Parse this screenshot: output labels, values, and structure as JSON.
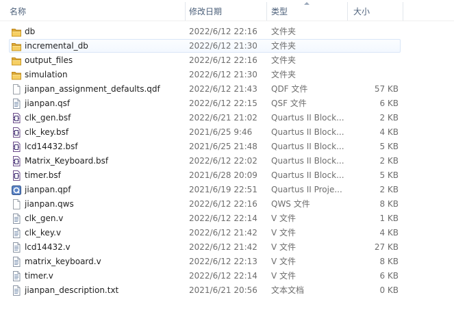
{
  "columns": {
    "name": "名称",
    "date": "修改日期",
    "type": "类型",
    "size": "大小"
  },
  "files": [
    {
      "name": "db",
      "date": "2022/6/12 22:16",
      "type": "文件夹",
      "size": "",
      "icon": "folder-icon"
    },
    {
      "name": "incremental_db",
      "date": "2022/6/12 21:30",
      "type": "文件夹",
      "size": "",
      "icon": "folder-icon"
    },
    {
      "name": "output_files",
      "date": "2022/6/12 22:16",
      "type": "文件夹",
      "size": "",
      "icon": "folder-icon"
    },
    {
      "name": "simulation",
      "date": "2022/6/12 21:30",
      "type": "文件夹",
      "size": "",
      "icon": "folder-icon"
    },
    {
      "name": "jianpan_assignment_defaults.qdf",
      "date": "2022/6/12 21:43",
      "type": "QDF 文件",
      "size": "57 KB",
      "icon": "blank-file-icon"
    },
    {
      "name": "jianpan.qsf",
      "date": "2022/6/12 22:15",
      "type": "QSF 文件",
      "size": "6 KB",
      "icon": "text-file-icon"
    },
    {
      "name": "clk_gen.bsf",
      "date": "2022/6/21 21:02",
      "type": "Quartus II Block...",
      "size": "2 KB",
      "icon": "quartus-block-icon"
    },
    {
      "name": "clk_key.bsf",
      "date": "2021/6/25 9:46",
      "type": "Quartus II Block...",
      "size": "4 KB",
      "icon": "quartus-block-icon"
    },
    {
      "name": "lcd14432.bsf",
      "date": "2021/6/25 21:48",
      "type": "Quartus II Block...",
      "size": "5 KB",
      "icon": "quartus-block-icon"
    },
    {
      "name": "Matrix_Keyboard.bsf",
      "date": "2022/6/12 22:02",
      "type": "Quartus II Block...",
      "size": "2 KB",
      "icon": "quartus-block-icon"
    },
    {
      "name": "timer.bsf",
      "date": "2021/6/28 20:09",
      "type": "Quartus II Block...",
      "size": "5 KB",
      "icon": "quartus-block-icon"
    },
    {
      "name": "jianpan.qpf",
      "date": "2021/6/19 22:51",
      "type": "Quartus II Proje...",
      "size": "2 KB",
      "icon": "quartus-project-icon"
    },
    {
      "name": "jianpan.qws",
      "date": "2022/6/12 22:16",
      "type": "QWS 文件",
      "size": "8 KB",
      "icon": "blank-file-icon"
    },
    {
      "name": "clk_gen.v",
      "date": "2022/6/12 22:14",
      "type": "V 文件",
      "size": "1 KB",
      "icon": "text-file-icon"
    },
    {
      "name": "clk_key.v",
      "date": "2022/6/12 21:42",
      "type": "V 文件",
      "size": "4 KB",
      "icon": "text-file-icon"
    },
    {
      "name": "lcd14432.v",
      "date": "2022/6/12 21:42",
      "type": "V 文件",
      "size": "27 KB",
      "icon": "text-file-icon"
    },
    {
      "name": "matrix_keyboard.v",
      "date": "2022/6/12 22:13",
      "type": "V 文件",
      "size": "8 KB",
      "icon": "text-file-icon"
    },
    {
      "name": "timer.v",
      "date": "2022/6/12 22:14",
      "type": "V 文件",
      "size": "6 KB",
      "icon": "text-file-icon"
    },
    {
      "name": "jianpan_description.txt",
      "date": "2021/6/21 20:56",
      "type": "文本文档",
      "size": "0 KB",
      "icon": "text-file-icon"
    }
  ],
  "hovered_index": 1
}
